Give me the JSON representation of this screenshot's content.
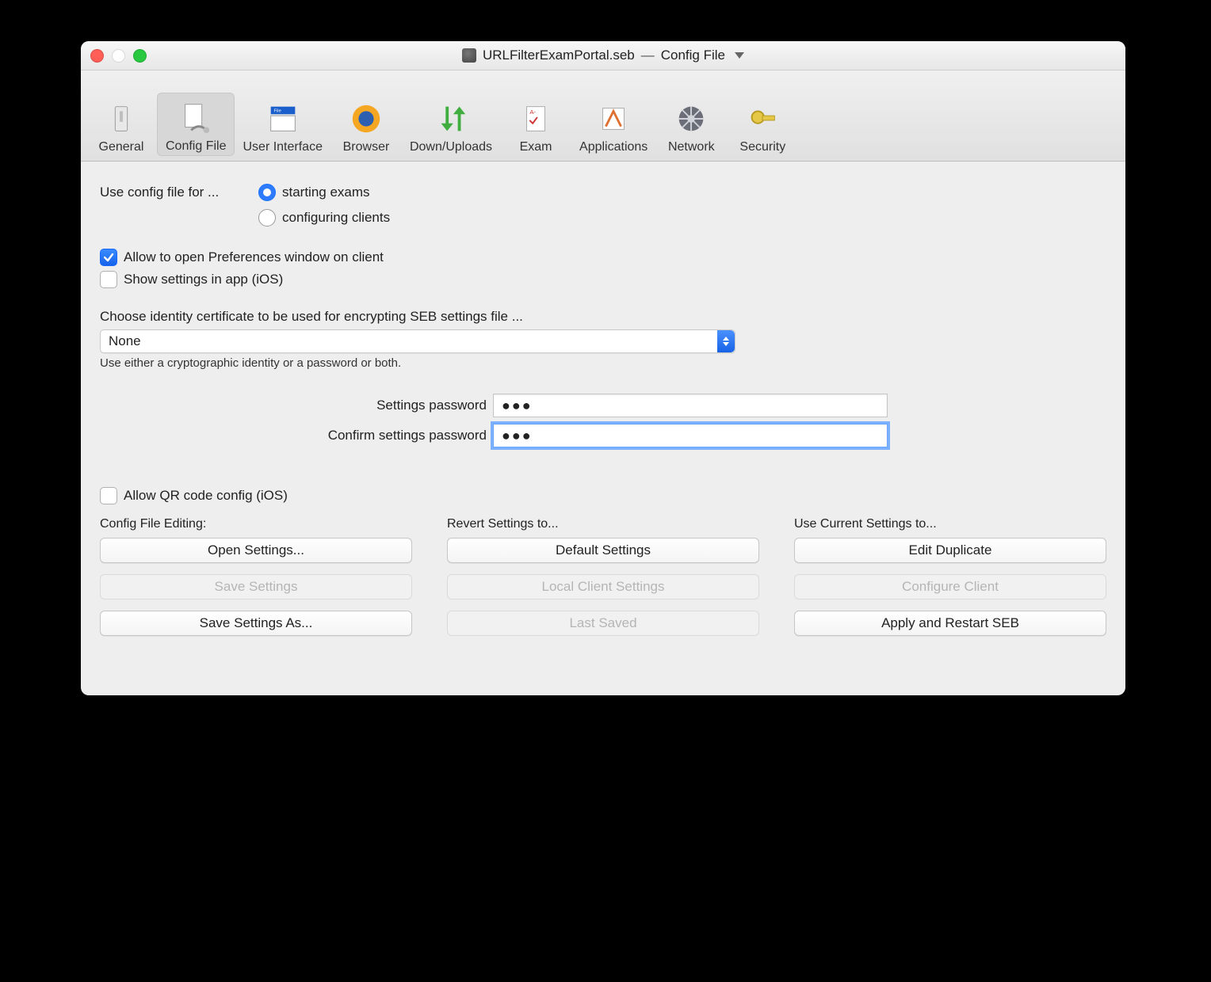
{
  "window": {
    "filename": "URLFilterExamPortal.seb",
    "separator": "—",
    "section": "Config File"
  },
  "toolbar": {
    "items": [
      {
        "label": "General",
        "active": false
      },
      {
        "label": "Config File",
        "active": true
      },
      {
        "label": "User Interface",
        "active": false
      },
      {
        "label": "Browser",
        "active": false
      },
      {
        "label": "Down/Uploads",
        "active": false
      },
      {
        "label": "Exam",
        "active": false
      },
      {
        "label": "Applications",
        "active": false
      },
      {
        "label": "Network",
        "active": false
      },
      {
        "label": "Security",
        "active": false
      }
    ]
  },
  "form": {
    "use_label": "Use config file for ...",
    "radio_starting": "starting exams",
    "radio_configuring": "configuring clients",
    "radio_selected": "starting",
    "allow_prefs": {
      "label": "Allow to open Preferences window on client",
      "checked": true
    },
    "show_ios": {
      "label": "Show settings in app (iOS)",
      "checked": false
    },
    "cert_label": "Choose identity certificate to be used for encrypting SEB settings file ...",
    "cert_value": "None",
    "cert_hint": "Use either a cryptographic identity or a password or both.",
    "pw_label": "Settings password",
    "pw_value": "●●●",
    "pw2_label": "Confirm settings password",
    "pw2_value": "●●●",
    "allow_qr": {
      "label": "Allow QR code config (iOS)",
      "checked": false
    }
  },
  "columns": {
    "editing": {
      "header": "Config File Editing:",
      "open": "Open Settings...",
      "save": "Save Settings",
      "saveas": "Save Settings As..."
    },
    "revert": {
      "header": "Revert Settings to...",
      "default": "Default Settings",
      "local": "Local Client Settings",
      "last": "Last Saved"
    },
    "use": {
      "header": "Use Current Settings to...",
      "edit": "Edit Duplicate",
      "configure": "Configure Client",
      "apply": "Apply and Restart SEB"
    }
  }
}
